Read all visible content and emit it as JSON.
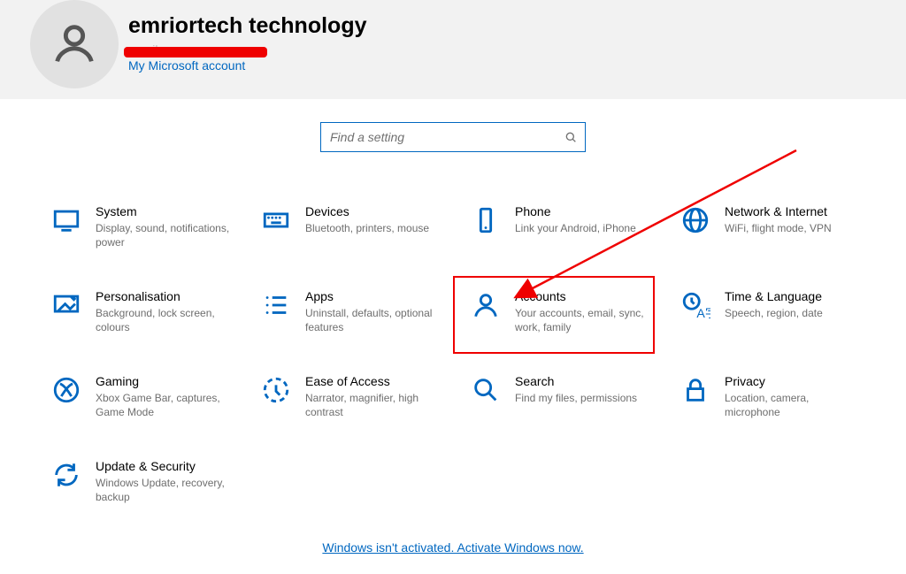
{
  "profile": {
    "display_name": "emriortech technology",
    "email_domain_hint": "gmail.com",
    "ms_account_link": "My Microsoft account"
  },
  "search": {
    "placeholder": "Find a setting"
  },
  "tiles": [
    {
      "id": "system",
      "title": "System",
      "desc": "Display, sound, notifications, power"
    },
    {
      "id": "devices",
      "title": "Devices",
      "desc": "Bluetooth, printers, mouse"
    },
    {
      "id": "phone",
      "title": "Phone",
      "desc": "Link your Android, iPhone"
    },
    {
      "id": "network",
      "title": "Network & Internet",
      "desc": "WiFi, flight mode, VPN"
    },
    {
      "id": "personal",
      "title": "Personalisation",
      "desc": "Background, lock screen, colours"
    },
    {
      "id": "apps",
      "title": "Apps",
      "desc": "Uninstall, defaults, optional features"
    },
    {
      "id": "accounts",
      "title": "Accounts",
      "desc": "Your accounts, email, sync, work, family"
    },
    {
      "id": "timelang",
      "title": "Time & Language",
      "desc": "Speech, region, date"
    },
    {
      "id": "gaming",
      "title": "Gaming",
      "desc": "Xbox Game Bar, captures, Game Mode"
    },
    {
      "id": "ease",
      "title": "Ease of Access",
      "desc": "Narrator, magnifier, high contrast"
    },
    {
      "id": "searchtile",
      "title": "Search",
      "desc": "Find my files, permissions"
    },
    {
      "id": "privacy",
      "title": "Privacy",
      "desc": "Location, camera, microphone"
    },
    {
      "id": "update",
      "title": "Update & Security",
      "desc": "Windows Update, recovery, backup"
    }
  ],
  "footer": {
    "activate_text": "Windows isn't activated. Activate Windows now."
  },
  "annotations": {
    "highlight_tile": "accounts"
  }
}
